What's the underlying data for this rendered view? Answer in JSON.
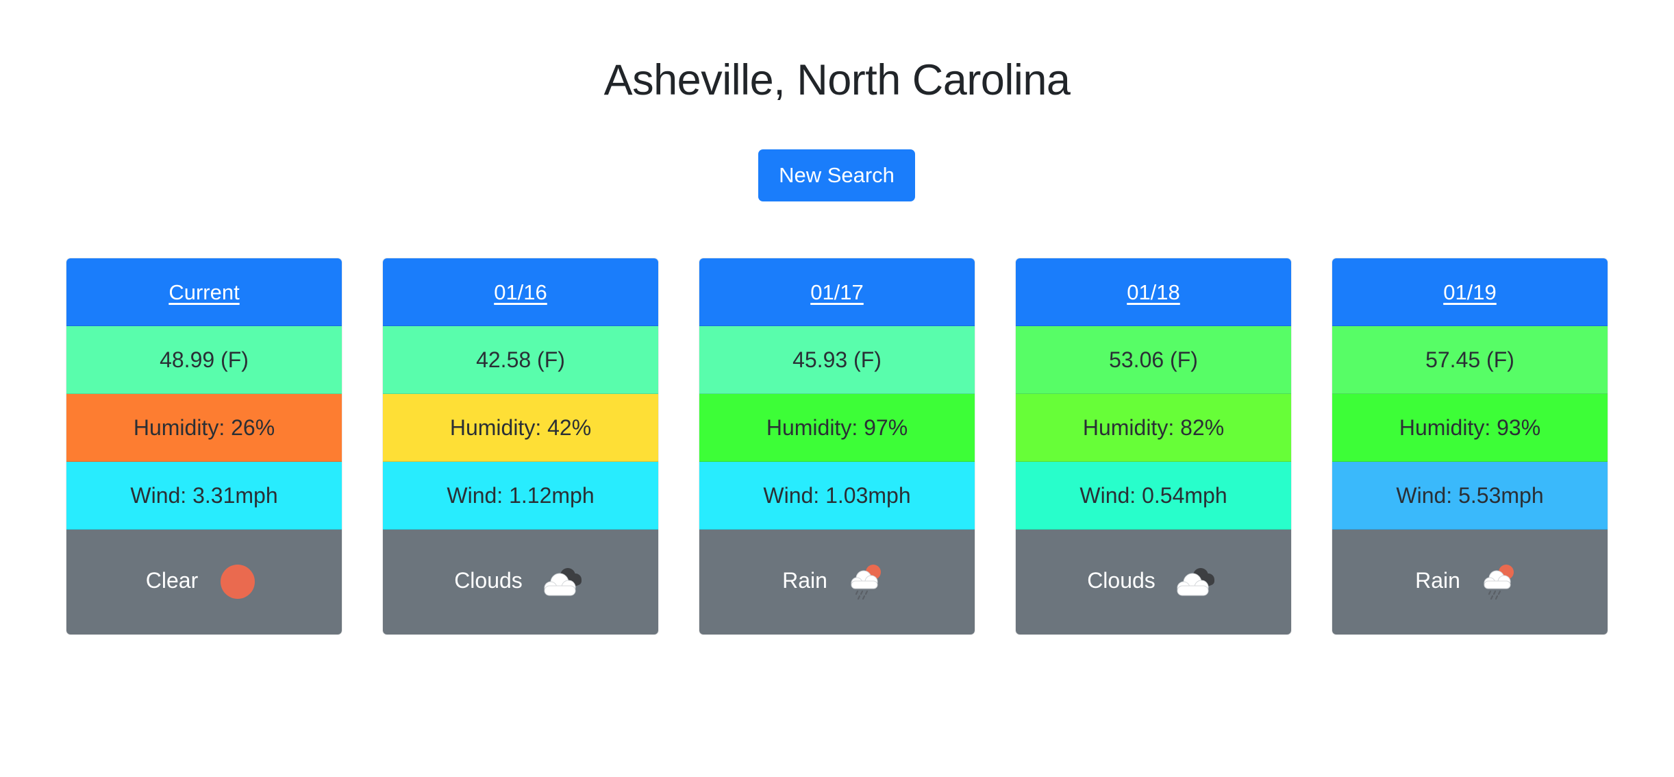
{
  "page": {
    "title": "Asheville, North Carolina"
  },
  "toolbar": {
    "new_search_label": "New Search"
  },
  "colors": {
    "header_blue": "#1a7dfb",
    "footer_gray": "#6c757d"
  },
  "forecast": [
    {
      "label": "Current",
      "temp": "48.99 (F)",
      "temp_color": "#59fdac",
      "humidity": "Humidity: 26%",
      "humidity_color": "#fd7d31",
      "wind": "Wind: 3.31mph",
      "wind_color": "#28ecfe",
      "condition": "Clear",
      "icon": "sun-icon"
    },
    {
      "label": "01/16",
      "temp": "42.58 (F)",
      "temp_color": "#59fdac",
      "humidity": "Humidity: 42%",
      "humidity_color": "#fedf36",
      "wind": "Wind: 1.12mph",
      "wind_color": "#28ecfe",
      "condition": "Clouds",
      "icon": "clouds-icon"
    },
    {
      "label": "01/17",
      "temp": "45.93 (F)",
      "temp_color": "#59fdac",
      "humidity": "Humidity: 97%",
      "humidity_color": "#3dfe37",
      "wind": "Wind: 1.03mph",
      "wind_color": "#28ecfe",
      "condition": "Rain",
      "icon": "rain-icon"
    },
    {
      "label": "01/18",
      "temp": "53.06 (F)",
      "temp_color": "#57fd66",
      "humidity": "Humidity: 82%",
      "humidity_color": "#67fe38",
      "wind": "Wind: 0.54mph",
      "wind_color": "#28fecb",
      "condition": "Clouds",
      "icon": "clouds-icon"
    },
    {
      "label": "01/19",
      "temp": "57.45 (F)",
      "temp_color": "#57fd66",
      "humidity": "Humidity: 93%",
      "humidity_color": "#3dfe37",
      "wind": "Wind: 5.53mph",
      "wind_color": "#3ab9fb",
      "condition": "Rain",
      "icon": "rain-icon"
    }
  ]
}
